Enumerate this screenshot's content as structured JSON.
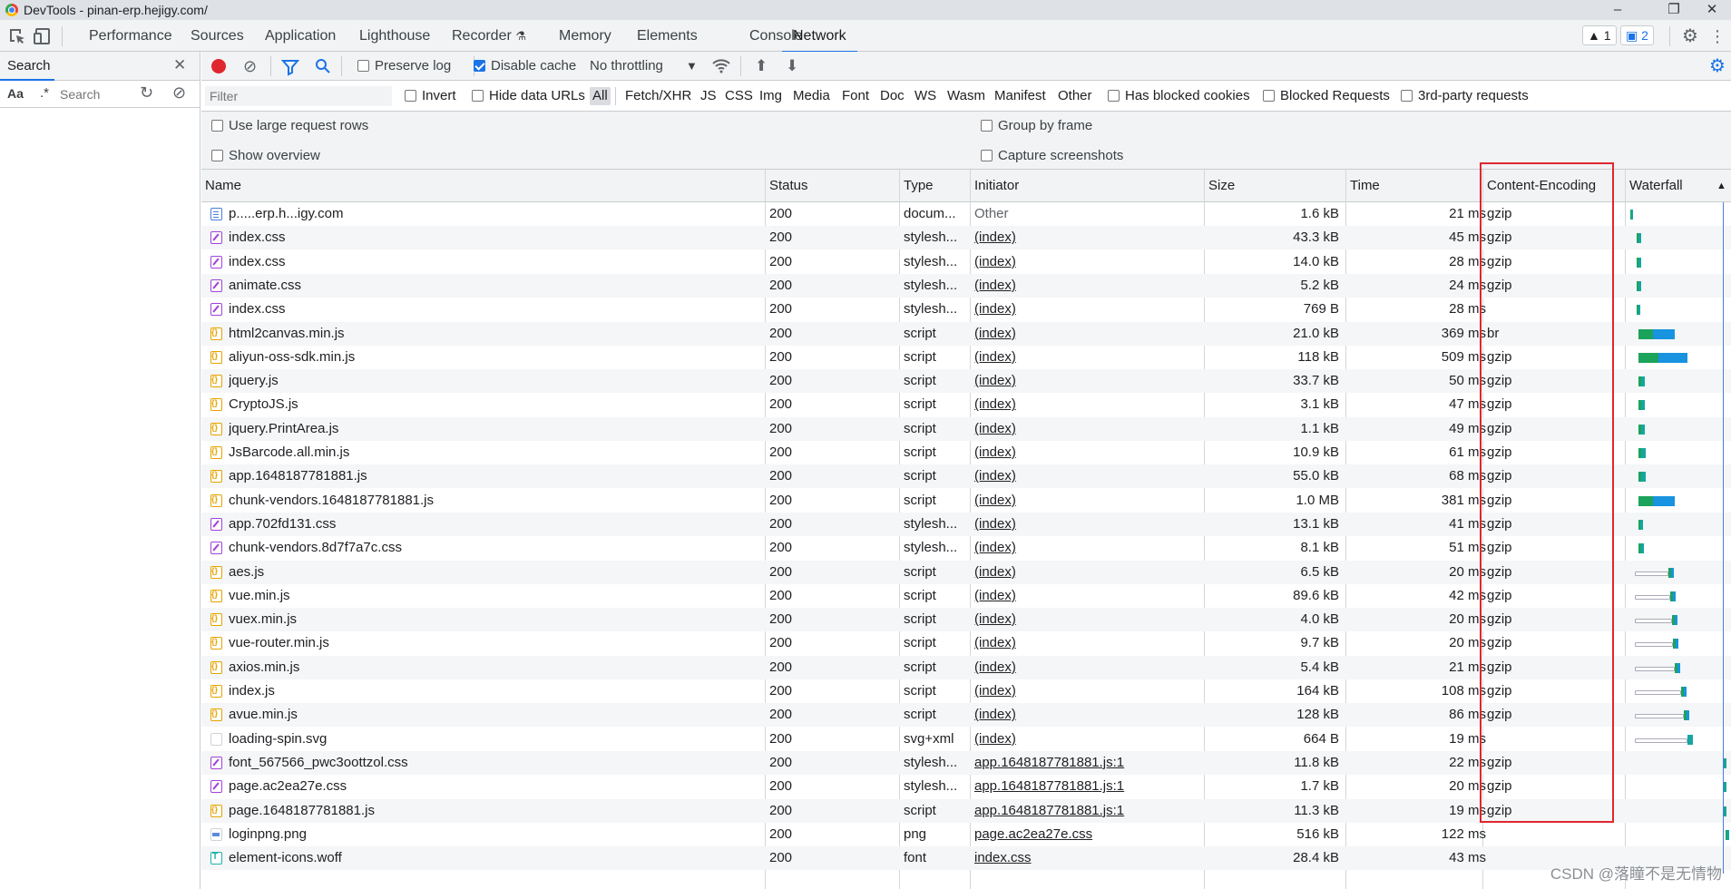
{
  "window": {
    "title": "DevTools - pinan-erp.hejigy.com/"
  },
  "tabs": [
    "Performance",
    "Sources",
    "Application",
    "Lighthouse",
    "Recorder",
    "Memory",
    "Elements",
    "Console",
    "Network"
  ],
  "active_tab": "Network",
  "badges": {
    "warnings": "1",
    "messages": "2"
  },
  "search_panel": {
    "title": "Search",
    "case_label": "Aa",
    "regex_label": ".*",
    "placeholder": "Search"
  },
  "toolbar": {
    "preserve_log": "Preserve log",
    "disable_cache": "Disable cache",
    "throttling": "No throttling"
  },
  "filter_bar": {
    "placeholder": "Filter",
    "invert": "Invert",
    "hide_data_urls": "Hide data URLs",
    "types": [
      "All",
      "Fetch/XHR",
      "JS",
      "CSS",
      "Img",
      "Media",
      "Font",
      "Doc",
      "WS",
      "Wasm",
      "Manifest",
      "Other"
    ],
    "has_blocked_cookies": "Has blocked cookies",
    "blocked_requests": "Blocked Requests",
    "third_party": "3rd-party requests"
  },
  "settings": {
    "large_rows": "Use large request rows",
    "group_by_frame": "Group by frame",
    "show_overview": "Show overview",
    "capture_screenshots": "Capture screenshots"
  },
  "columns": {
    "name": "Name",
    "status": "Status",
    "type": "Type",
    "initiator": "Initiator",
    "size": "Size",
    "time": "Time",
    "encoding": "Content-Encoding",
    "waterfall": "Waterfall"
  },
  "rows": [
    {
      "name": "p.....erp.h...igy.com",
      "icon": "doc",
      "status": "200",
      "type": "docum...",
      "initiator": "Other",
      "size": "1.6 kB",
      "time": "21 ms",
      "enc": "gzip"
    },
    {
      "name": "index.css",
      "icon": "css",
      "status": "200",
      "type": "stylesh...",
      "initiator": "(index)",
      "size": "43.3 kB",
      "time": "45 ms",
      "enc": "gzip"
    },
    {
      "name": "index.css",
      "icon": "css",
      "status": "200",
      "type": "stylesh...",
      "initiator": "(index)",
      "size": "14.0 kB",
      "time": "28 ms",
      "enc": "gzip"
    },
    {
      "name": "animate.css",
      "icon": "css",
      "status": "200",
      "type": "stylesh...",
      "initiator": "(index)",
      "size": "5.2 kB",
      "time": "24 ms",
      "enc": "gzip"
    },
    {
      "name": "index.css",
      "icon": "css",
      "status": "200",
      "type": "stylesh...",
      "initiator": "(index)",
      "size": "769 B",
      "time": "28 ms",
      "enc": ""
    },
    {
      "name": "html2canvas.min.js",
      "icon": "js",
      "status": "200",
      "type": "script",
      "initiator": "(index)",
      "size": "21.0 kB",
      "time": "369 ms",
      "enc": "br"
    },
    {
      "name": "aliyun-oss-sdk.min.js",
      "icon": "js",
      "status": "200",
      "type": "script",
      "initiator": "(index)",
      "size": "118 kB",
      "time": "509 ms",
      "enc": "gzip"
    },
    {
      "name": "jquery.js",
      "icon": "js",
      "status": "200",
      "type": "script",
      "initiator": "(index)",
      "size": "33.7 kB",
      "time": "50 ms",
      "enc": "gzip"
    },
    {
      "name": "CryptoJS.js",
      "icon": "js",
      "status": "200",
      "type": "script",
      "initiator": "(index)",
      "size": "3.1 kB",
      "time": "47 ms",
      "enc": "gzip"
    },
    {
      "name": "jquery.PrintArea.js",
      "icon": "js",
      "status": "200",
      "type": "script",
      "initiator": "(index)",
      "size": "1.1 kB",
      "time": "49 ms",
      "enc": "gzip"
    },
    {
      "name": "JsBarcode.all.min.js",
      "icon": "js",
      "status": "200",
      "type": "script",
      "initiator": "(index)",
      "size": "10.9 kB",
      "time": "61 ms",
      "enc": "gzip"
    },
    {
      "name": "app.1648187781881.js",
      "icon": "js",
      "status": "200",
      "type": "script",
      "initiator": "(index)",
      "size": "55.0 kB",
      "time": "68 ms",
      "enc": "gzip"
    },
    {
      "name": "chunk-vendors.1648187781881.js",
      "icon": "js",
      "status": "200",
      "type": "script",
      "initiator": "(index)",
      "size": "1.0 MB",
      "time": "381 ms",
      "enc": "gzip"
    },
    {
      "name": "app.702fd131.css",
      "icon": "css",
      "status": "200",
      "type": "stylesh...",
      "initiator": "(index)",
      "size": "13.1 kB",
      "time": "41 ms",
      "enc": "gzip"
    },
    {
      "name": "chunk-vendors.8d7f7a7c.css",
      "icon": "css",
      "status": "200",
      "type": "stylesh...",
      "initiator": "(index)",
      "size": "8.1 kB",
      "time": "51 ms",
      "enc": "gzip"
    },
    {
      "name": "aes.js",
      "icon": "js",
      "status": "200",
      "type": "script",
      "initiator": "(index)",
      "size": "6.5 kB",
      "time": "20 ms",
      "enc": "gzip"
    },
    {
      "name": "vue.min.js",
      "icon": "js",
      "status": "200",
      "type": "script",
      "initiator": "(index)",
      "size": "89.6 kB",
      "time": "42 ms",
      "enc": "gzip"
    },
    {
      "name": "vuex.min.js",
      "icon": "js",
      "status": "200",
      "type": "script",
      "initiator": "(index)",
      "size": "4.0 kB",
      "time": "20 ms",
      "enc": "gzip"
    },
    {
      "name": "vue-router.min.js",
      "icon": "js",
      "status": "200",
      "type": "script",
      "initiator": "(index)",
      "size": "9.7 kB",
      "time": "20 ms",
      "enc": "gzip"
    },
    {
      "name": "axios.min.js",
      "icon": "js",
      "status": "200",
      "type": "script",
      "initiator": "(index)",
      "size": "5.4 kB",
      "time": "21 ms",
      "enc": "gzip"
    },
    {
      "name": "index.js",
      "icon": "js",
      "status": "200",
      "type": "script",
      "initiator": "(index)",
      "size": "164 kB",
      "time": "108 ms",
      "enc": "gzip"
    },
    {
      "name": "avue.min.js",
      "icon": "js",
      "status": "200",
      "type": "script",
      "initiator": "(index)",
      "size": "128 kB",
      "time": "86 ms",
      "enc": "gzip"
    },
    {
      "name": "loading-spin.svg",
      "icon": "svg",
      "status": "200",
      "type": "svg+xml",
      "initiator": "(index)",
      "size": "664 B",
      "time": "19 ms",
      "enc": ""
    },
    {
      "name": "font_567566_pwc3oottzol.css",
      "icon": "css",
      "status": "200",
      "type": "stylesh...",
      "initiator": "app.1648187781881.js:1",
      "size": "11.8 kB",
      "time": "22 ms",
      "enc": "gzip"
    },
    {
      "name": "page.ac2ea27e.css",
      "icon": "css",
      "status": "200",
      "type": "stylesh...",
      "initiator": "app.1648187781881.js:1",
      "size": "1.7 kB",
      "time": "20 ms",
      "enc": "gzip"
    },
    {
      "name": "page.1648187781881.js",
      "icon": "js",
      "status": "200",
      "type": "script",
      "initiator": "app.1648187781881.js:1",
      "size": "11.3 kB",
      "time": "19 ms",
      "enc": "gzip"
    },
    {
      "name": "loginpng.png",
      "icon": "png",
      "status": "200",
      "type": "png",
      "initiator": "page.ac2ea27e.css",
      "size": "516 kB",
      "time": "122 ms",
      "enc": ""
    },
    {
      "name": "element-icons.woff",
      "icon": "font",
      "status": "200",
      "type": "font",
      "initiator": "index.css",
      "size": "28.4 kB",
      "time": "43 ms",
      "enc": ""
    }
  ],
  "watermark": "CSDN @落瞳不是无情物",
  "colors": {
    "accent": "#1a73e8",
    "highlight": "#e0272f",
    "wf_green": "#1ca35b",
    "wf_blue": "#1793e0",
    "wf_teal": "#15a6a0"
  }
}
